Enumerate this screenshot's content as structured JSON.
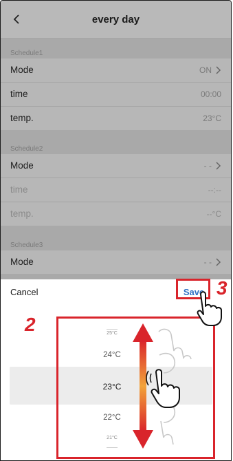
{
  "header": {
    "title": "every day"
  },
  "schedules": [
    {
      "label": "Schedule1",
      "mode_label": "Mode",
      "mode_value": "ON",
      "time_label": "time",
      "time_value": "00:00",
      "temp_label": "temp.",
      "temp_value": "23°C"
    },
    {
      "label": "Schedule2",
      "mode_label": "Mode",
      "mode_value": "- -",
      "time_label": "time",
      "time_value": "--:--",
      "temp_label": "temp.",
      "temp_value": "--°C"
    },
    {
      "label": "Schedule3",
      "mode_label": "Mode",
      "mode_value": "- -"
    }
  ],
  "sheet": {
    "cancel_label": "Cancel",
    "save_label": "Save",
    "options": [
      "25°C",
      "24°C",
      "23°C",
      "22°C",
      "21°C"
    ],
    "selected": "23°C"
  },
  "annotations": {
    "step2": "2",
    "step3": "3"
  },
  "colors": {
    "accent_red": "#d9242b",
    "save_blue": "#2c6fc4",
    "arrow_orange": "#f2a33a"
  },
  "icons": [
    "back-chevron-icon",
    "chevron-right-icon",
    "hand-pointer-icon",
    "hand-swipe-icon",
    "up-down-arrow-icon"
  ]
}
